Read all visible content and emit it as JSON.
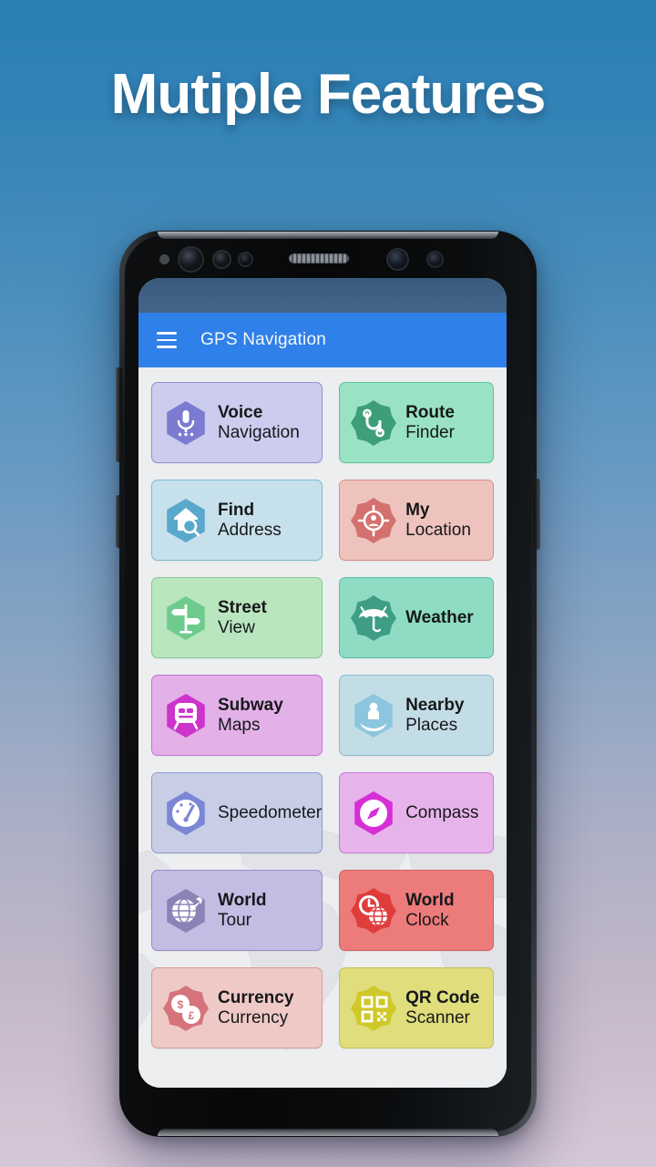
{
  "headline": "Mutiple Features",
  "phone": {
    "statusbar": "",
    "appbar": {
      "menu_icon": "hamburger-menu-icon",
      "title": "GPS Navigation"
    }
  },
  "colors": {
    "background_top": "#2a7fb5",
    "background_bottom": "#d6c8d8",
    "appbar": "#2f80e8",
    "headline_text": "#ffffff",
    "tile_text": "#17181a"
  },
  "features": [
    {
      "id": "voice-navigation",
      "line1": "Voice",
      "line2": "Navigation",
      "icon": "microphone-icon",
      "tile_bg": "#ccccee",
      "tile_border": "#8f8fd6",
      "badge": "#7b7bd1",
      "shape": "hexagon"
    },
    {
      "id": "route-finder",
      "line1": "Route",
      "line2": "Finder",
      "icon": "route-path-icon",
      "tile_bg": "#99e3c4",
      "tile_border": "#5cc49c",
      "badge": "#3d9e79",
      "shape": "starburst"
    },
    {
      "id": "find-address",
      "line1": "Find",
      "line2": "Address",
      "icon": "home-search-icon",
      "tile_bg": "#c7e1ec",
      "tile_border": "#7fb9d4",
      "badge": "#5aa8cc",
      "shape": "hexagon"
    },
    {
      "id": "my-location",
      "line1": "My",
      "line2": "Location",
      "icon": "location-target-icon",
      "tile_bg": "#efc3bd",
      "tile_border": "#d98e86",
      "badge": "#d4716f",
      "shape": "starburst"
    },
    {
      "id": "street-view",
      "line1": "Street",
      "line2": "View",
      "icon": "signpost-icon",
      "tile_bg": "#b9e6bf",
      "tile_border": "#84ca95",
      "badge": "#6ecb8d",
      "shape": "hexagon"
    },
    {
      "id": "weather",
      "line1": "Weather",
      "line2": "",
      "icon": "umbrella-icon",
      "tile_bg": "#8fdcc4",
      "tile_border": "#58bfa2",
      "badge": "#3f9d86",
      "shape": "starburst"
    },
    {
      "id": "subway-maps",
      "line1": "Subway",
      "line2": "Maps",
      "icon": "train-icon",
      "tile_bg": "#e3b1e8",
      "tile_border": "#c473d3",
      "badge": "#cc34cc",
      "shape": "hexagon"
    },
    {
      "id": "nearby-places",
      "line1": "Nearby",
      "line2": "Places",
      "icon": "person-place-icon",
      "tile_bg": "#c3dde6",
      "tile_border": "#8fbccf",
      "badge": "#8cc6de",
      "shape": "hexagon"
    },
    {
      "id": "speedometer",
      "line1": "Speedometer",
      "line2": "",
      "icon": "gauge-icon",
      "tile_bg": "#c8cee6",
      "tile_border": "#8d9ad0",
      "badge": "#7b86d4",
      "shape": "hexagon",
      "weight": "regular"
    },
    {
      "id": "compass",
      "line1": "Compass",
      "line2": "",
      "icon": "compass-icon",
      "tile_bg": "#e6b4ea",
      "tile_border": "#cb7ad8",
      "badge": "#d62fd6",
      "shape": "hexagon",
      "weight": "regular"
    },
    {
      "id": "world-tour",
      "line1": "World",
      "line2": "Tour",
      "icon": "globe-plane-icon",
      "tile_bg": "#c3bde4",
      "tile_border": "#958ccb",
      "badge": "#8a83b5",
      "shape": "hexagon"
    },
    {
      "id": "world-clock",
      "line1": "World",
      "line2": "Clock",
      "icon": "clock-globe-icon",
      "tile_bg": "#ec7b7b",
      "tile_border": "#d45e5e",
      "badge": "#e03c3c",
      "shape": "starburst"
    },
    {
      "id": "currency",
      "line1": "Currency",
      "line2": "Currency",
      "icon": "coins-icon",
      "tile_bg": "#eec9c6",
      "tile_border": "#d79b97",
      "badge": "#d4737a",
      "shape": "starburst"
    },
    {
      "id": "qr-code-scanner",
      "line1": "QR Code",
      "line2": "Scanner",
      "icon": "qr-code-icon",
      "tile_bg": "#e0dd7c",
      "tile_border": "#c4c057",
      "badge": "#cfc828",
      "shape": "starburst"
    }
  ]
}
